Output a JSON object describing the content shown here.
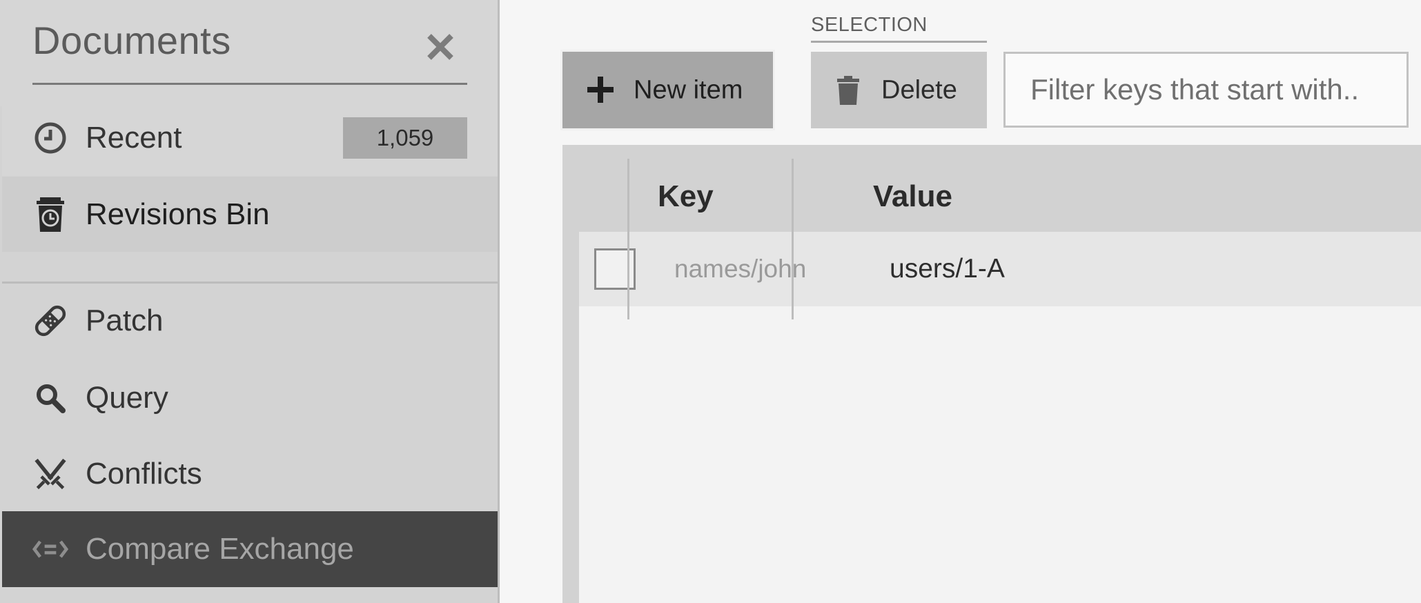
{
  "sidebar": {
    "title": "Documents",
    "items": [
      {
        "label": "Recent",
        "badge": "1,059",
        "icon": "clock-icon"
      },
      {
        "label": "Revisions Bin",
        "icon": "revisions-bin-icon"
      },
      {
        "label": "Patch",
        "icon": "bandage-icon"
      },
      {
        "label": "Query",
        "icon": "search-icon"
      },
      {
        "label": "Conflicts",
        "icon": "crossed-swords-icon"
      },
      {
        "label": "Compare Exchange",
        "icon": "compare-exchange-icon",
        "active": true
      }
    ]
  },
  "toolbar": {
    "selection_label": "SELECTION",
    "new_item_label": "New item",
    "delete_label": "Delete",
    "filter_placeholder": "Filter keys that start with.."
  },
  "table": {
    "columns": [
      "Key",
      "Value"
    ],
    "rows": [
      {
        "key": "names/john",
        "value": "users/1-A"
      }
    ]
  }
}
